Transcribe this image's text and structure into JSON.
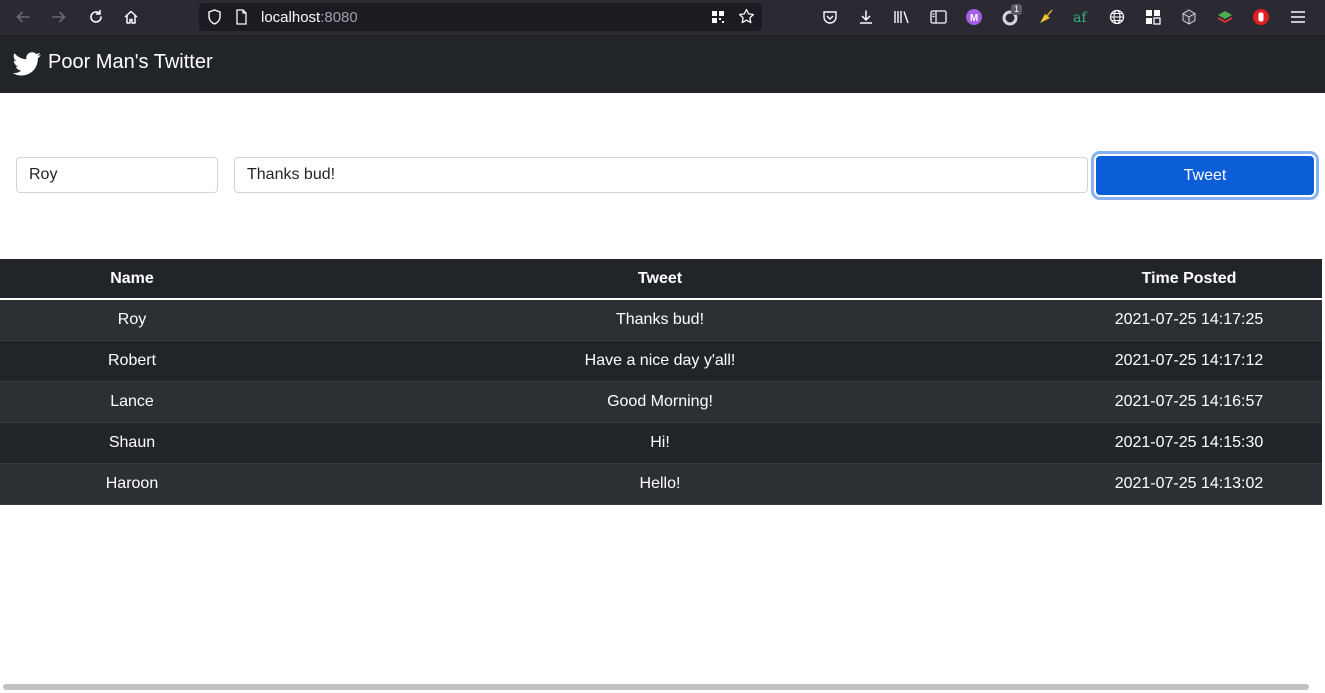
{
  "browser": {
    "url_host": "localhost",
    "url_port": ":8080",
    "extension_badge": "1",
    "extension_m_label": "M"
  },
  "navbar": {
    "brand": "Poor Man's Twitter"
  },
  "form": {
    "name_value": "Roy",
    "tweet_value": "Thanks bud!",
    "submit_label": "Tweet"
  },
  "table": {
    "headers": {
      "name": "Name",
      "tweet": "Tweet",
      "time": "Time Posted"
    },
    "rows": [
      {
        "name": "Roy",
        "tweet": "Thanks bud!",
        "time": "2021-07-25 14:17:25"
      },
      {
        "name": "Robert",
        "tweet": "Have a nice day y'all!",
        "time": "2021-07-25 14:17:12"
      },
      {
        "name": "Lance",
        "tweet": "Good Morning!",
        "time": "2021-07-25 14:16:57"
      },
      {
        "name": "Shaun",
        "tweet": "Hi!",
        "time": "2021-07-25 14:15:30"
      },
      {
        "name": "Haroon",
        "tweet": "Hello!",
        "time": "2021-07-25 14:13:02"
      }
    ]
  },
  "colors": {
    "navbar_bg": "#212529",
    "button_primary": "#0b5ed7",
    "toolbar_bg": "#2b2a33"
  }
}
